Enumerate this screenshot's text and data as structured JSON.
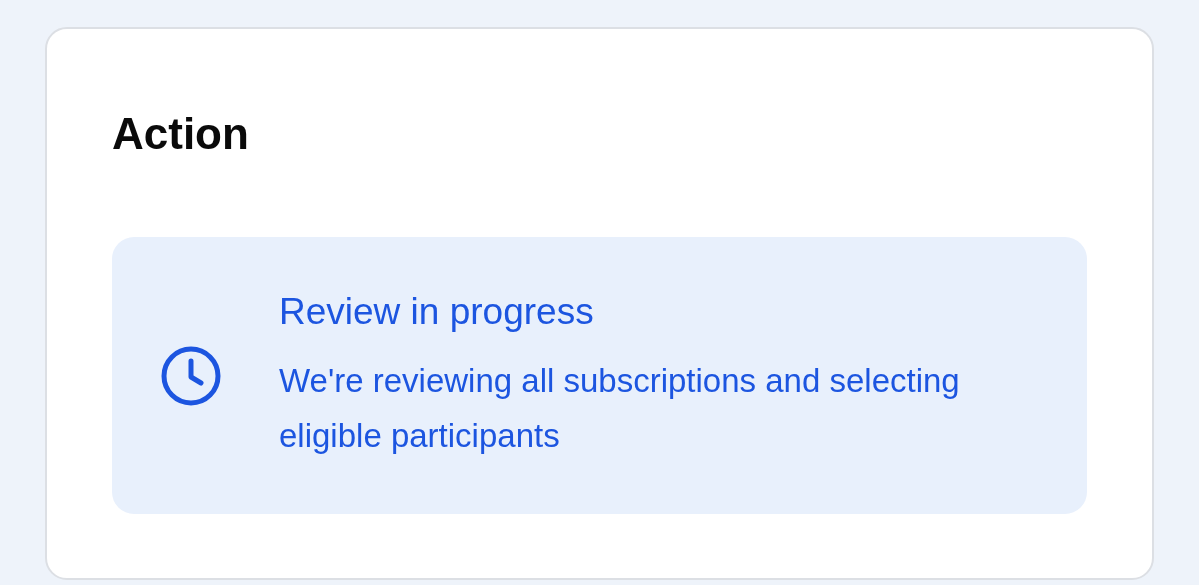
{
  "card": {
    "title": "Action"
  },
  "status": {
    "kind": "pending",
    "title": "Review in progress",
    "description": "We're reviewing all subscriptions and selecting eligible participants"
  }
}
